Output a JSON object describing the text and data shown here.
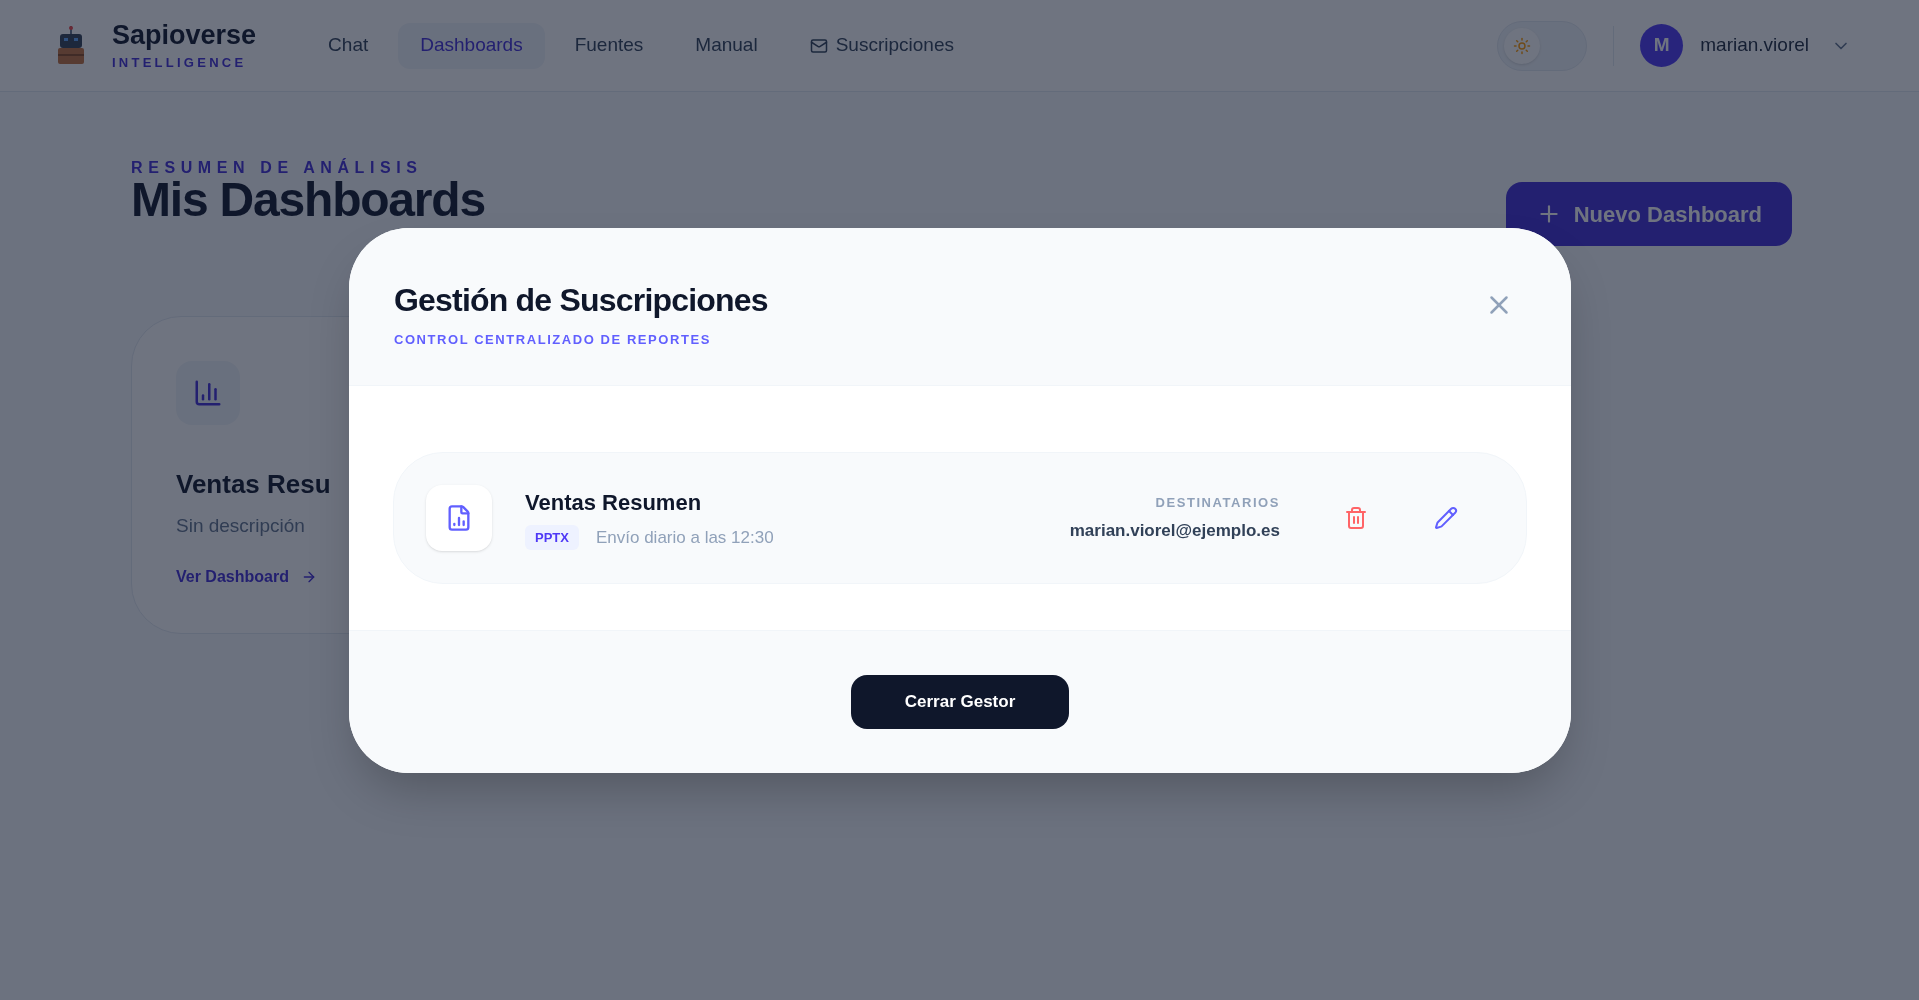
{
  "header": {
    "brand": "Sapioverse",
    "tagline": "INTELLIGENCE",
    "nav": [
      {
        "label": "Chat",
        "selected": false,
        "kind": "text"
      },
      {
        "label": "Dashboards",
        "selected": true,
        "kind": "text"
      },
      {
        "label": "Fuentes",
        "selected": false,
        "kind": "text"
      },
      {
        "label": "Manual",
        "selected": false,
        "kind": "text"
      },
      {
        "label": "Suscripciones",
        "selected": false,
        "kind": "mail"
      }
    ],
    "theme_toggle": {
      "on": false
    },
    "user": {
      "initial": "M",
      "name": "marian.viorel"
    }
  },
  "page": {
    "eyebrow": "RESUMEN DE ANÁLISIS",
    "title": "Mis Dashboards",
    "new_button": "Nuevo Dashboard",
    "cards": [
      {
        "title": "Ventas Resu",
        "description": "Sin descripción",
        "link": "Ver Dashboard"
      }
    ]
  },
  "modal": {
    "title": "Gestión de Suscripciones",
    "subtitle": "CONTROL CENTRALIZADO DE REPORTES",
    "subscriptions": [
      {
        "name": "Ventas Resumen",
        "format": "PPTX",
        "schedule": "Envío diario a las 12:30",
        "recipients_label": "DESTINATARIOS",
        "recipients": "marian.viorel@ejemplo.es"
      }
    ],
    "close_button": "Cerrar Gestor"
  }
}
